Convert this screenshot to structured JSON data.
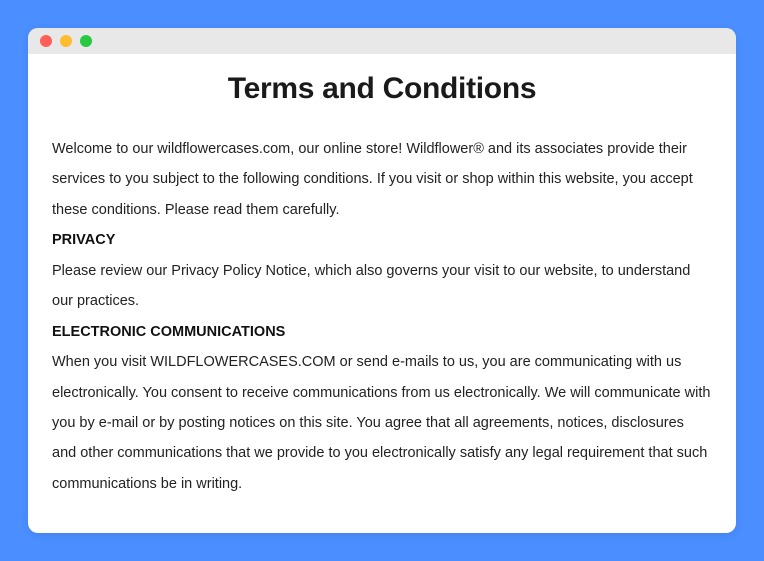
{
  "title": "Terms and Conditions",
  "intro": "Welcome to our wildflowercases.com, our online store! Wildflower® and its associates provide their services to you subject to the following conditions. If you visit or shop within this website, you accept these conditions. Please read them carefully.",
  "sections": [
    {
      "heading": "PRIVACY",
      "body": "Please review our Privacy Policy Notice, which also governs your visit to our website, to understand our practices."
    },
    {
      "heading": "ELECTRONIC COMMUNICATIONS",
      "body": "When you visit WILDFLOWERCASES.COM or send e-mails to us, you are communicating with us electronically. You consent to receive communications from us electronically. We will communicate with you by e-mail or by posting notices on this site. You agree that all agreements, notices, disclosures and other communications that we provide to you electronically satisfy any legal requirement that such communications be in writing."
    }
  ]
}
